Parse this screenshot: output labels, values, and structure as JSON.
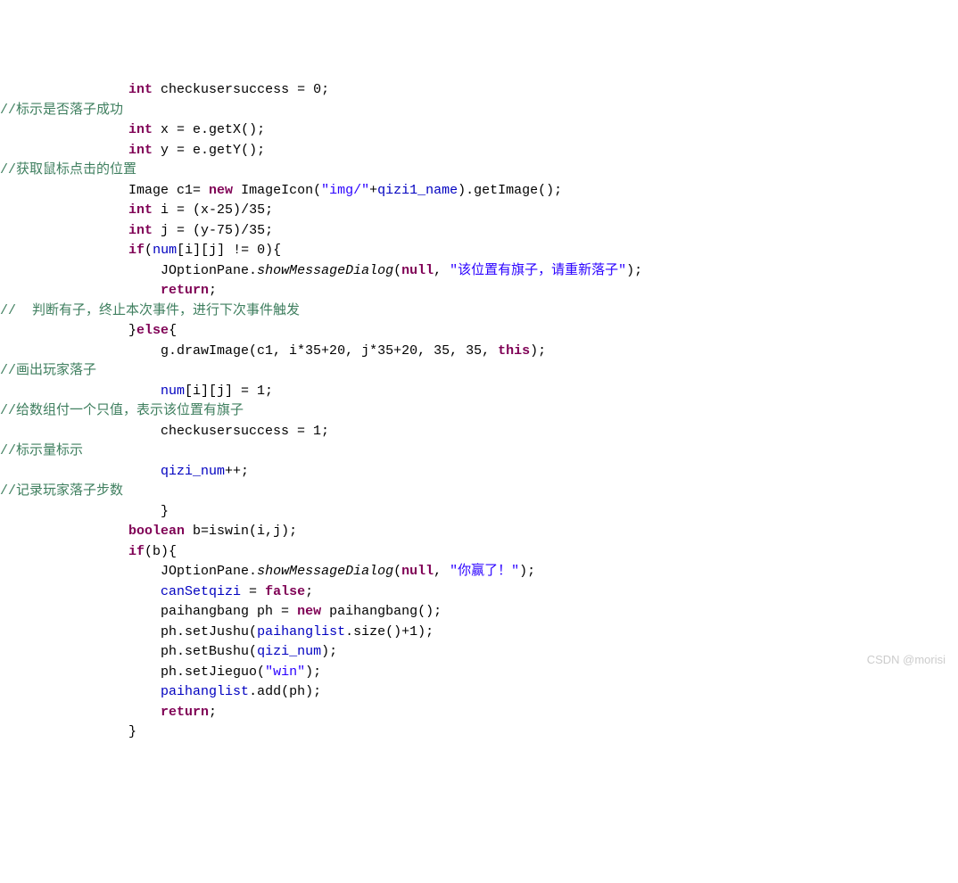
{
  "code": {
    "l01a": "int",
    "l01b": " checkusersuccess = 0;",
    "c01": "//标示是否落子成功",
    "l02a": "int",
    "l02b": " x = e.getX();",
    "l03a": "int",
    "l03b": " y = e.getY();",
    "c02": "//获取鼠标点击的位置",
    "l04a": "Image c1= ",
    "l04b": "new",
    "l04c": " ImageIcon(",
    "l04d": "\"img/\"",
    "l04e": "+",
    "l04f": "qizi1_name",
    "l04g": ").getImage();",
    "l05a": "int",
    "l05b": " i = (x-25)/35;",
    "l06a": "int",
    "l06b": " j = (y-75)/35;",
    "l07a": "if",
    "l07b": "(",
    "l07c": "num",
    "l07d": "[i][j] != 0){",
    "l08a": "JOptionPane.",
    "l08b": "showMessageDialog",
    "l08c": "(",
    "l08d": "null",
    "l08e": ", ",
    "l08f": "\"该位置有旗子，请重新落子\"",
    "l08g": ");",
    "l09a": "return",
    "l09b": ";",
    "c03": "//  判断有子，终止本次事件，进行下次事件触发",
    "l10a": "}",
    "l10b": "else",
    "l10c": "{",
    "l11a": "g.drawImage(c1, i*35+20, j*35+20, 35, 35, ",
    "l11b": "this",
    "l11c": ");",
    "c04": "//画出玩家落子",
    "l12a": "num",
    "l12b": "[i][j] = 1;",
    "c05": "//给数组付一个只值，表示该位置有旗子",
    "l13": "checkusersuccess = 1;",
    "c06": "//标示量标示",
    "l14a": "qizi_num",
    "l14b": "++;",
    "c07": "//记录玩家落子步数",
    "l15": "}",
    "l16a": "boolean",
    "l16b": " b=iswin(i,j);",
    "l17a": "if",
    "l17b": "(b){",
    "l18a": "JOptionPane.",
    "l18b": "showMessageDialog",
    "l18c": "(",
    "l18d": "null",
    "l18e": ", ",
    "l18f": "\"你赢了！\"",
    "l18g": ");",
    "l19a": "canSetqizi",
    "l19b": " = ",
    "l19c": "false",
    "l19d": ";",
    "l20a": "paihangbang ph = ",
    "l20b": "new",
    "l20c": " paihangbang();",
    "l21a": "ph.setJushu(",
    "l21b": "paihanglist",
    "l21c": ".size()+1);",
    "l22a": "ph.setBushu(",
    "l22b": "qizi_num",
    "l22c": ");",
    "l23a": "ph.setJieguo(",
    "l23b": "\"win\"",
    "l23c": ");",
    "l24a": "paihanglist",
    "l24b": ".add(ph);",
    "l25a": "return",
    "l25b": ";",
    "l26": "}"
  },
  "watermark": "CSDN @morisi"
}
